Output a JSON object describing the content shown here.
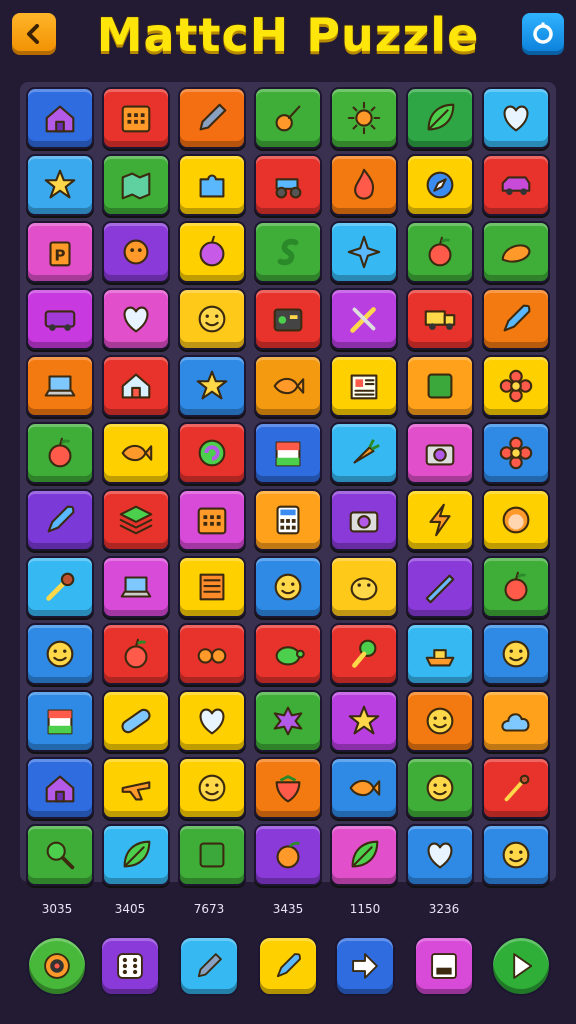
{
  "header": {
    "title": "MattcH Puzzle",
    "back_icon": "chevron-left-icon",
    "settings_icon": "gear-icon"
  },
  "board": {
    "rows": [
      [
        {
          "c": "#2f6ce0",
          "i": "house-icon"
        },
        {
          "c": "#e8332c",
          "i": "calendar-icon"
        },
        {
          "c": "#f36f12",
          "i": "pencil-icon"
        },
        {
          "c": "#3fae38",
          "i": "guitar-icon"
        },
        {
          "c": "#43b23a",
          "i": "sun-icon"
        },
        {
          "c": "#2fa645",
          "i": "leaf-icon"
        },
        {
          "c": "#36b8f2",
          "i": "heart-icon"
        }
      ],
      [
        {
          "c": "#3aa9ee",
          "i": "star-icon"
        },
        {
          "c": "#3fae38",
          "i": "map-icon"
        },
        {
          "c": "#ffd000",
          "i": "puzzle-icon"
        },
        {
          "c": "#e8332c",
          "i": "tractor-icon"
        },
        {
          "c": "#f37a10",
          "i": "flame-icon"
        },
        {
          "c": "#ffd000",
          "i": "compass-icon"
        },
        {
          "c": "#e8332c",
          "i": "car-icon"
        }
      ],
      [
        {
          "c": "#e24fcb",
          "i": "parking-sign-icon"
        },
        {
          "c": "#8a3ad8",
          "i": "monkey-icon"
        },
        {
          "c": "#ffd000",
          "i": "onion-icon"
        },
        {
          "c": "#3fae38",
          "i": "snake-icon"
        },
        {
          "c": "#36b8f2",
          "i": "sparkle-icon"
        },
        {
          "c": "#3fae38",
          "i": "apple-icon"
        },
        {
          "c": "#3fae38",
          "i": "shell-icon"
        }
      ],
      [
        {
          "c": "#c83ae0",
          "i": "bus-icon"
        },
        {
          "c": "#e24fcb",
          "i": "heart-icon"
        },
        {
          "c": "#ffc91a",
          "i": "face-icon"
        },
        {
          "c": "#e8332c",
          "i": "radio-icon"
        },
        {
          "c": "#b93fe0",
          "i": "tools-icon"
        },
        {
          "c": "#e8332c",
          "i": "truck-icon"
        },
        {
          "c": "#f37a10",
          "i": "rocket-icon"
        }
      ],
      [
        {
          "c": "#f37a10",
          "i": "laptop-icon"
        },
        {
          "c": "#e8332c",
          "i": "barn-icon"
        },
        {
          "c": "#2f8ae6",
          "i": "star-icon"
        },
        {
          "c": "#f39a10",
          "i": "fish-icon"
        },
        {
          "c": "#ffd000",
          "i": "newspaper-icon"
        },
        {
          "c": "#ffa11a",
          "i": "box-icon"
        },
        {
          "c": "#ffd000",
          "i": "flower-icon"
        }
      ],
      [
        {
          "c": "#3fae38",
          "i": "apple-icon"
        },
        {
          "c": "#ffd000",
          "i": "fish-icon"
        },
        {
          "c": "#e8332c",
          "i": "swirl-icon"
        },
        {
          "c": "#2f6ce0",
          "i": "flag-icon"
        },
        {
          "c": "#36b8f2",
          "i": "carrot-icon"
        },
        {
          "c": "#e24fcb",
          "i": "camera-icon"
        },
        {
          "c": "#2f8ae6",
          "i": "flower-icon"
        }
      ],
      [
        {
          "c": "#7b3ad8",
          "i": "rocket-icon"
        },
        {
          "c": "#e8332c",
          "i": "layers-icon"
        },
        {
          "c": "#d84ad8",
          "i": "calendar-icon"
        },
        {
          "c": "#ffa11a",
          "i": "calculator-icon"
        },
        {
          "c": "#8a3ad8",
          "i": "camera-icon"
        },
        {
          "c": "#ffd000",
          "i": "lightning-icon"
        },
        {
          "c": "#ffd000",
          "i": "girl-icon"
        }
      ],
      [
        {
          "c": "#36b8f2",
          "i": "wrench-icon"
        },
        {
          "c": "#d84ad8",
          "i": "laptop-icon"
        },
        {
          "c": "#ffd000",
          "i": "note-icon"
        },
        {
          "c": "#2f8ae6",
          "i": "face-icon"
        },
        {
          "c": "#ffc91a",
          "i": "hippo-icon"
        },
        {
          "c": "#8a3ad8",
          "i": "ruler-icon"
        },
        {
          "c": "#3fae38",
          "i": "apple-icon"
        }
      ],
      [
        {
          "c": "#2f8ae6",
          "i": "face-icon"
        },
        {
          "c": "#e8332c",
          "i": "apple-icon"
        },
        {
          "c": "#e8332c",
          "i": "binoculars-icon"
        },
        {
          "c": "#e8332c",
          "i": "turtle-icon"
        },
        {
          "c": "#e8332c",
          "i": "ice-cream-icon"
        },
        {
          "c": "#36b8f2",
          "i": "boat-icon"
        },
        {
          "c": "#2f8ae6",
          "i": "face-icon"
        }
      ],
      [
        {
          "c": "#2f8ae6",
          "i": "flag-icon"
        },
        {
          "c": "#ffd000",
          "i": "bandage-icon"
        },
        {
          "c": "#ffd000",
          "i": "heart-icon"
        },
        {
          "c": "#3fae38",
          "i": "splat-icon"
        },
        {
          "c": "#b93fe0",
          "i": "star-icon"
        },
        {
          "c": "#f37a10",
          "i": "face-icon"
        },
        {
          "c": "#ffa11a",
          "i": "cloud-icon"
        }
      ],
      [
        {
          "c": "#2f6ce0",
          "i": "house-icon"
        },
        {
          "c": "#ffd000",
          "i": "airplane-icon"
        },
        {
          "c": "#ffd000",
          "i": "face-icon"
        },
        {
          "c": "#f37a10",
          "i": "strawberry-icon"
        },
        {
          "c": "#2f8ae6",
          "i": "fish-icon"
        },
        {
          "c": "#3fae38",
          "i": "face-icon"
        },
        {
          "c": "#e8332c",
          "i": "matchstick-icon"
        }
      ],
      [
        {
          "c": "#3fae38",
          "i": "magnifier-icon"
        },
        {
          "c": "#36b8f2",
          "i": "leaf-icon"
        },
        {
          "c": "#3fae38",
          "i": "box-icon"
        },
        {
          "c": "#8a3ad8",
          "i": "orange-icon"
        },
        {
          "c": "#e24fcb",
          "i": "leaf-icon"
        },
        {
          "c": "#2f8ae6",
          "i": "heart-icon"
        },
        {
          "c": "#2f8ae6",
          "i": "face-icon"
        }
      ]
    ]
  },
  "powerups": [
    {
      "value": "3035",
      "color": "#47b83a",
      "icon": "target-icon",
      "round": true
    },
    {
      "value": "3405",
      "color": "#8a3ad8",
      "icon": "dice-icon",
      "round": false
    },
    {
      "value": "7673",
      "color": "#36b8f2",
      "icon": "pencil-icon",
      "round": false
    },
    {
      "value": "3435",
      "color": "#ffd000",
      "icon": "rocket-icon",
      "round": false
    },
    {
      "value": "1150",
      "color": "#2f6ce0",
      "icon": "arrow-right-icon",
      "round": false
    },
    {
      "value": "3236",
      "color": "#d84ad8",
      "icon": "save-icon",
      "round": false
    },
    {
      "value": "",
      "color": "#2fae38",
      "icon": "play-icon",
      "round": true
    }
  ]
}
